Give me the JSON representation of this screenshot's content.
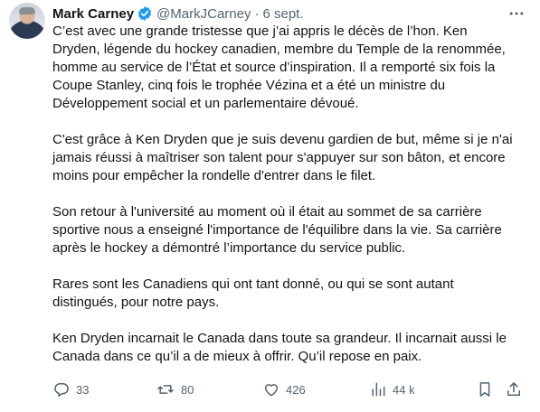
{
  "author": {
    "name": "Mark Carney",
    "handle": "@MarkJCarney",
    "separator": "·",
    "date": "6 sept."
  },
  "tweet": {
    "paragraphs": [
      "C’est avec une grande tristesse que j’ai appris le décès de l’hon. Ken\nDryden, légende du hockey canadien, membre du Temple de la renommée,\nhomme au service de l’État et source d’inspiration. Il a remporté six fois la\nCoupe Stanley, cinq fois le trophée Vézina et a été un ministre du\nDéveloppement social et un parlementaire dévoué.",
      "C'est grâce à Ken Dryden que je suis devenu gardien de but, même si je n'ai\njamais réussi à maîtriser son talent pour s'appuyer sur son bâton, et encore\nmoins pour empêcher la rondelle d'entrer dans le filet.",
      "Son retour à l'université au moment où il était au sommet de sa carrière\nsportive nous a enseigné l'importance de l'équilibre dans la vie. Sa carrière\naprès le hockey a démontré l’importance du service public.",
      "Rares sont les Canadiens qui ont tant donné, ou qui se sont autant\ndistingués, pour notre pays.",
      "Ken Dryden incarnait le Canada dans toute sa grandeur. Il incarnait aussi le\nCanada dans ce qu’il a de mieux à offrir. Qu’il repose en paix."
    ]
  },
  "actions": {
    "replies": "33",
    "retweets": "80",
    "likes": "426",
    "views": "44 k"
  },
  "colors": {
    "text": "#0f1419",
    "secondary": "#536471",
    "verified": "#1d9bf0"
  },
  "icons": [
    "verified-badge-icon",
    "more-icon",
    "reply-icon",
    "retweet-icon",
    "like-icon",
    "views-icon",
    "bookmark-icon",
    "share-icon"
  ]
}
